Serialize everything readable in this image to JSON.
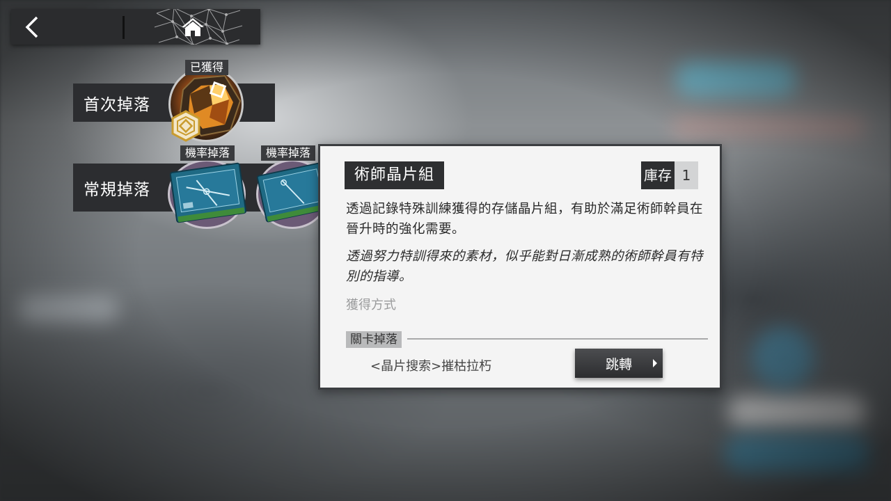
{
  "nav": {
    "back_icon": "chevron-left-icon",
    "home_icon": "home-icon"
  },
  "drops": {
    "first_drop_label": "首次掉落",
    "regular_drop_label": "常規掉落",
    "first_item_badge": "已獲得",
    "regular_item_1_badge": "機率掉落",
    "regular_item_2_badge": "機率掉落"
  },
  "item_detail": {
    "name": "術師晶片組",
    "stock_label": "庫存",
    "stock_count": "1",
    "description": "透過記錄特殊訓練獲得的存儲晶片組，有助於滿足術師幹員在晉升時的強化需要。",
    "lore": "透過努力特訓得來的素材，似乎能對日漸成熟的術師幹員有特別的指導。",
    "obtain_heading": "獲得方式",
    "source_tag": "關卡掉落",
    "stage_name": "<晶片搜索>摧枯拉朽",
    "jump_label": "跳轉"
  },
  "colors": {
    "panel_bg": "#f4f4f4",
    "dark_label": "#2e2f31",
    "chip_teal": "#1e6b86",
    "gold": "#d8a53a"
  }
}
